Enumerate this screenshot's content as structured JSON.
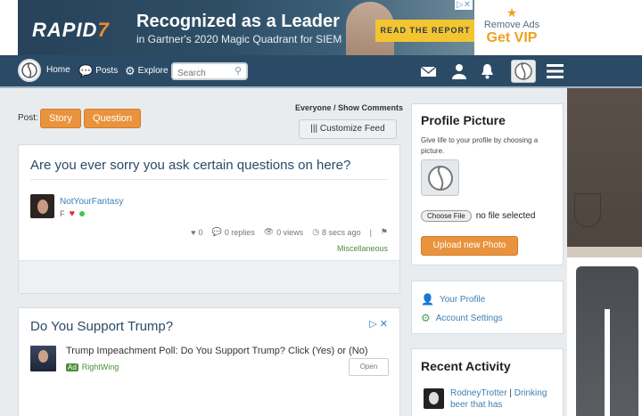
{
  "top_ad": {
    "brand_a": "RAPID",
    "brand_b": "7",
    "headline": "Recognized as a Leader",
    "subline": "in Gartner's 2020 Magic Quadrant for SIEM",
    "cta": "READ THE REPORT",
    "remove_ads_label": "Remove Ads",
    "get_vip_label": "Get VIP"
  },
  "nav": {
    "home": "Home",
    "posts": "Posts",
    "explore": "Explore",
    "search_placeholder": "Search"
  },
  "post_bar": {
    "label": "Post:",
    "tags": [
      "Story",
      "Question"
    ],
    "filters": "Everyone / Show Comments",
    "customize": "Customize Feed"
  },
  "question": {
    "title": "Are you ever sorry you ask certain questions on here?",
    "username": "NotYourFantasy",
    "gender": "F",
    "likes": "0",
    "replies": "0 replies",
    "views": "0 views",
    "time": "8 secs ago",
    "category": "Miscellaneous"
  },
  "ad_card": {
    "title": "Do You Support Trump?",
    "text": "Trump Impeachment Poll: Do You Support Trump? Click (Yes) or (No)",
    "ad_label": "Ad",
    "source": "RightWing",
    "open": "Open"
  },
  "profile_picture": {
    "title": "Profile Picture",
    "desc": "Give life to your profile by choosing a picture.",
    "choose": "Choose File",
    "no_file": "no file selected",
    "upload": "Upload new Photo"
  },
  "links": {
    "your_profile": "Your Profile",
    "account_settings": "Account Settings"
  },
  "recent_activity": {
    "title": "Recent Activity",
    "user": "RodneyTrotter",
    "separator": "|",
    "text": "Drinking beer that has"
  },
  "colors": {
    "nav_bg": "#2b4a66",
    "accent_orange": "#e9933d",
    "link_blue": "#3d7fb3",
    "green": "#4a8e3d"
  }
}
